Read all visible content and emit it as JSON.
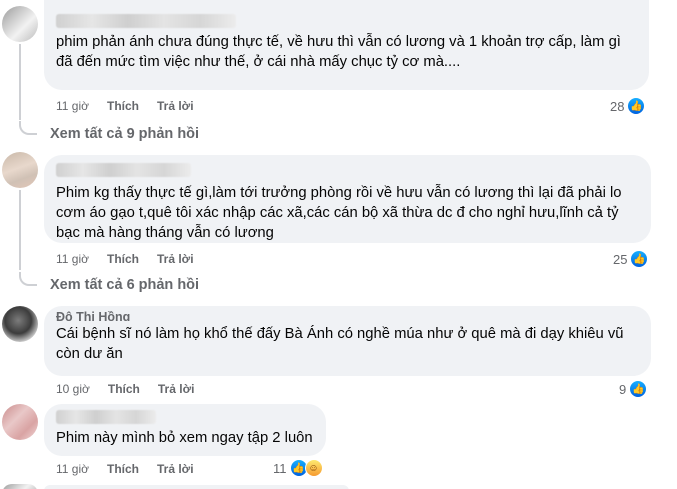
{
  "comments": [
    {
      "text": "phim phản ánh chưa đúng thực tế, về hưu thì vẫn có lương và 1 khoản trợ cấp, làm gì đã đến mức tìm việc như thế, ở cái nhà mấy chục tỷ cơ mà....",
      "time": "11 giờ",
      "like_label": "Thích",
      "reply_label": "Trả lời",
      "reactions": "28",
      "view_replies": "Xem tất cả 9 phản hồi"
    },
    {
      "text": "Phim kg thấy thực tế gì,làm tới trưởng phòng rồi về hưu vẫn có lương thì lại đã phải lo cơm áo gạo t,quê tôi xác nhập các xã,các cán bộ xã thừa dc đ cho nghỉ hưu,lĩnh cả tỷ bạc mà hàng tháng vẫn có lương",
      "time": "11 giờ",
      "like_label": "Thích",
      "reply_label": "Trả lời",
      "reactions": "25",
      "view_replies": "Xem tất cả 6 phản hồi"
    },
    {
      "author_partial": "Đỗ Thị Hồng",
      "text": "Cái bệnh sĩ nó làm họ khổ thế đấy Bà Ánh có nghề múa như ở quê mà đi dạy khiêu vũ còn dư ăn",
      "time": "10 giờ",
      "like_label": "Thích",
      "reply_label": "Trả lời",
      "reactions": "9"
    },
    {
      "text": "Phim này mình bỏ xem ngay tập 2 luôn",
      "time": "11 giờ",
      "like_label": "Thích",
      "reply_label": "Trả lời",
      "reactions": "11"
    }
  ],
  "icons": {
    "like": "like-icon",
    "haha": "haha-icon"
  },
  "colors": {
    "bubble": "#f0f2f5",
    "meta": "#65676b",
    "like_blue": "#0866ff"
  }
}
